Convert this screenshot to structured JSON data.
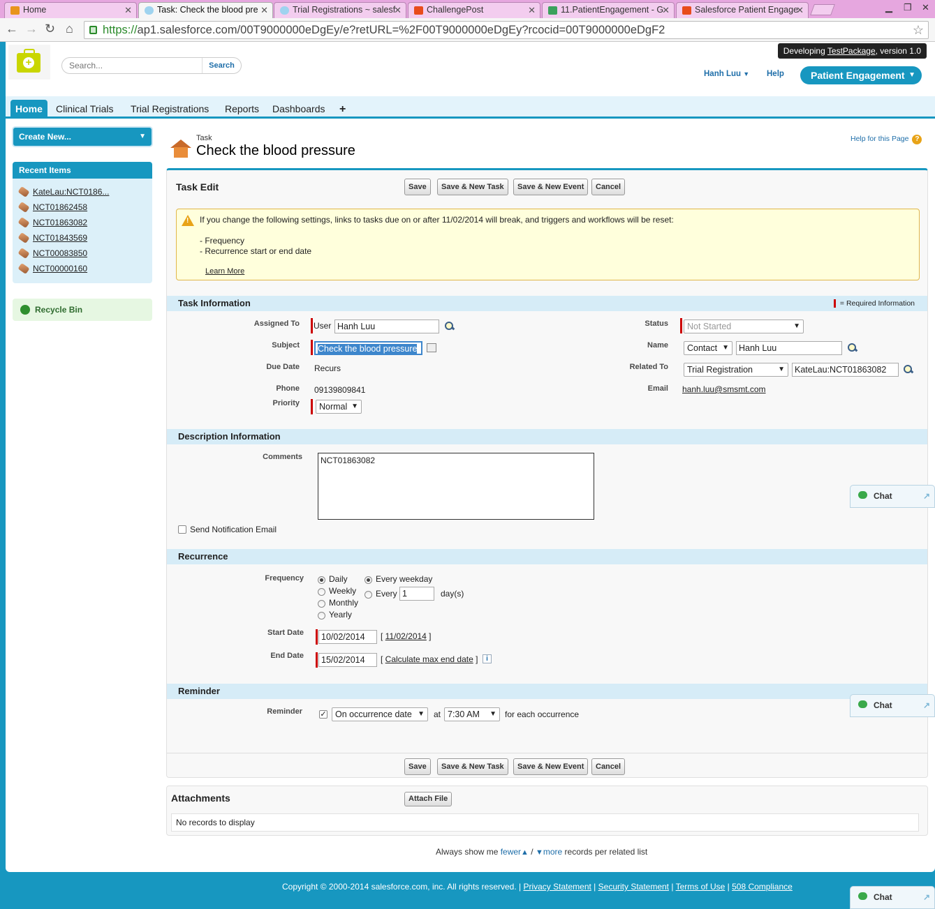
{
  "browser": {
    "tabs": [
      {
        "title": "Home",
        "color": "#e8941c"
      },
      {
        "title": "Task: Check the blood pre",
        "color": "#9fd3ef"
      },
      {
        "title": "Trial Registrations ~ salesf",
        "color": "#9fd3ef"
      },
      {
        "title": "ChallengePost",
        "color": "#e84c1c"
      },
      {
        "title": "11.PatientEngagement - G",
        "color": "#3ba15c"
      },
      {
        "title": "Salesforce Patient Engage",
        "color": "#e84c1c"
      }
    ],
    "url_scheme": "https://",
    "url_rest": "ap1.salesforce.com/00T9000000eDgEy/e?retURL=%2F00T9000000eDgEy?rcocid=00T9000000eDgF2"
  },
  "header": {
    "search_placeholder": "Search...",
    "search_button": "Search",
    "dev_prefix": "Developing ",
    "dev_package": "TestPackage",
    "dev_suffix": ", version 1.0",
    "user": "Hanh Luu",
    "help": "Help",
    "app": "Patient Engagement"
  },
  "nav_tabs": [
    "Home",
    "Clinical Trials",
    "Trial Registrations",
    "Reports",
    "Dashboards",
    "+"
  ],
  "sidebar": {
    "create_new": "Create New...",
    "recent_title": "Recent Items",
    "recent_items": [
      "KateLau:NCT0186...",
      "NCT01862458",
      "NCT01863082",
      "NCT01843569",
      "NCT00083850",
      "NCT00000160"
    ],
    "recycle_bin": "Recycle Bin"
  },
  "page": {
    "object_type": "Task",
    "title": "Check the blood pressure",
    "help_for_page": "Help for this Page"
  },
  "form": {
    "heading": "Task Edit",
    "buttons": {
      "save": "Save",
      "save_new_task": "Save & New Task",
      "save_new_event": "Save & New Event",
      "cancel": "Cancel"
    },
    "warning": {
      "line1": "If you change the following settings, links to tasks due on or after 11/02/2014 will break, and triggers and workflows will be reset:",
      "item1": "- Frequency",
      "item2": "- Recurrence start or end date",
      "learn_more": "Learn More"
    },
    "task_info": {
      "title": "Task Information",
      "required_legend": "= Required Information",
      "assigned_to_label": "Assigned To",
      "assigned_to_type": "User",
      "assigned_to_value": "Hanh Luu",
      "subject_label": "Subject",
      "subject_value": "Check the blood pressure",
      "due_date_label": "Due Date",
      "due_date_value": "Recurs",
      "phone_label": "Phone",
      "phone_value": "09139809841",
      "priority_label": "Priority",
      "priority_value": "Normal",
      "status_label": "Status",
      "status_value": "Not Started",
      "name_label": "Name",
      "name_type": "Contact",
      "name_value": "Hanh Luu",
      "related_to_label": "Related To",
      "related_to_type": "Trial Registration",
      "related_to_value": "KateLau:NCT01863082",
      "email_label": "Email",
      "email_value": "hanh.luu@smsmt.com"
    },
    "description": {
      "title": "Description Information",
      "comments_label": "Comments",
      "comments_value": "NCT01863082",
      "send_notification": "Send Notification Email"
    },
    "recurrence": {
      "title": "Recurrence",
      "frequency_label": "Frequency",
      "frequencies": [
        "Daily",
        "Weekly",
        "Monthly",
        "Yearly"
      ],
      "selected_frequency": "Daily",
      "every_weekday": "Every weekday",
      "every": "Every",
      "every_value": "1",
      "days_unit": "day(s)",
      "start_date_label": "Start Date",
      "start_date_value": "10/02/2014",
      "start_date_today": "11/02/2014",
      "end_date_label": "End Date",
      "end_date_value": "15/02/2014",
      "calc_max_end_date": "Calculate max end date"
    },
    "reminder": {
      "title": "Reminder",
      "label": "Reminder",
      "when": "On occurrence date",
      "at": "at",
      "time": "7:30 AM",
      "suffix": "for each occurrence"
    }
  },
  "attachments": {
    "title": "Attachments",
    "attach_button": "Attach File",
    "empty": "No records to display"
  },
  "related_list_pref": {
    "prefix": "Always show me ",
    "fewer": "fewer",
    "sep": " / ",
    "more": "more",
    "suffix": " records per related list"
  },
  "footer": {
    "copyright": "Copyright © 2000-2014 salesforce.com, inc. All rights reserved.",
    "links": [
      "Privacy Statement",
      "Security Statement",
      "Terms of Use",
      "508 Compliance"
    ]
  },
  "chat_label": "Chat",
  "colors": {
    "brand": "#1797c0",
    "tab_strip": "#e6a7df",
    "required": "#cc0000",
    "warning_bg": "#ffffdc"
  }
}
